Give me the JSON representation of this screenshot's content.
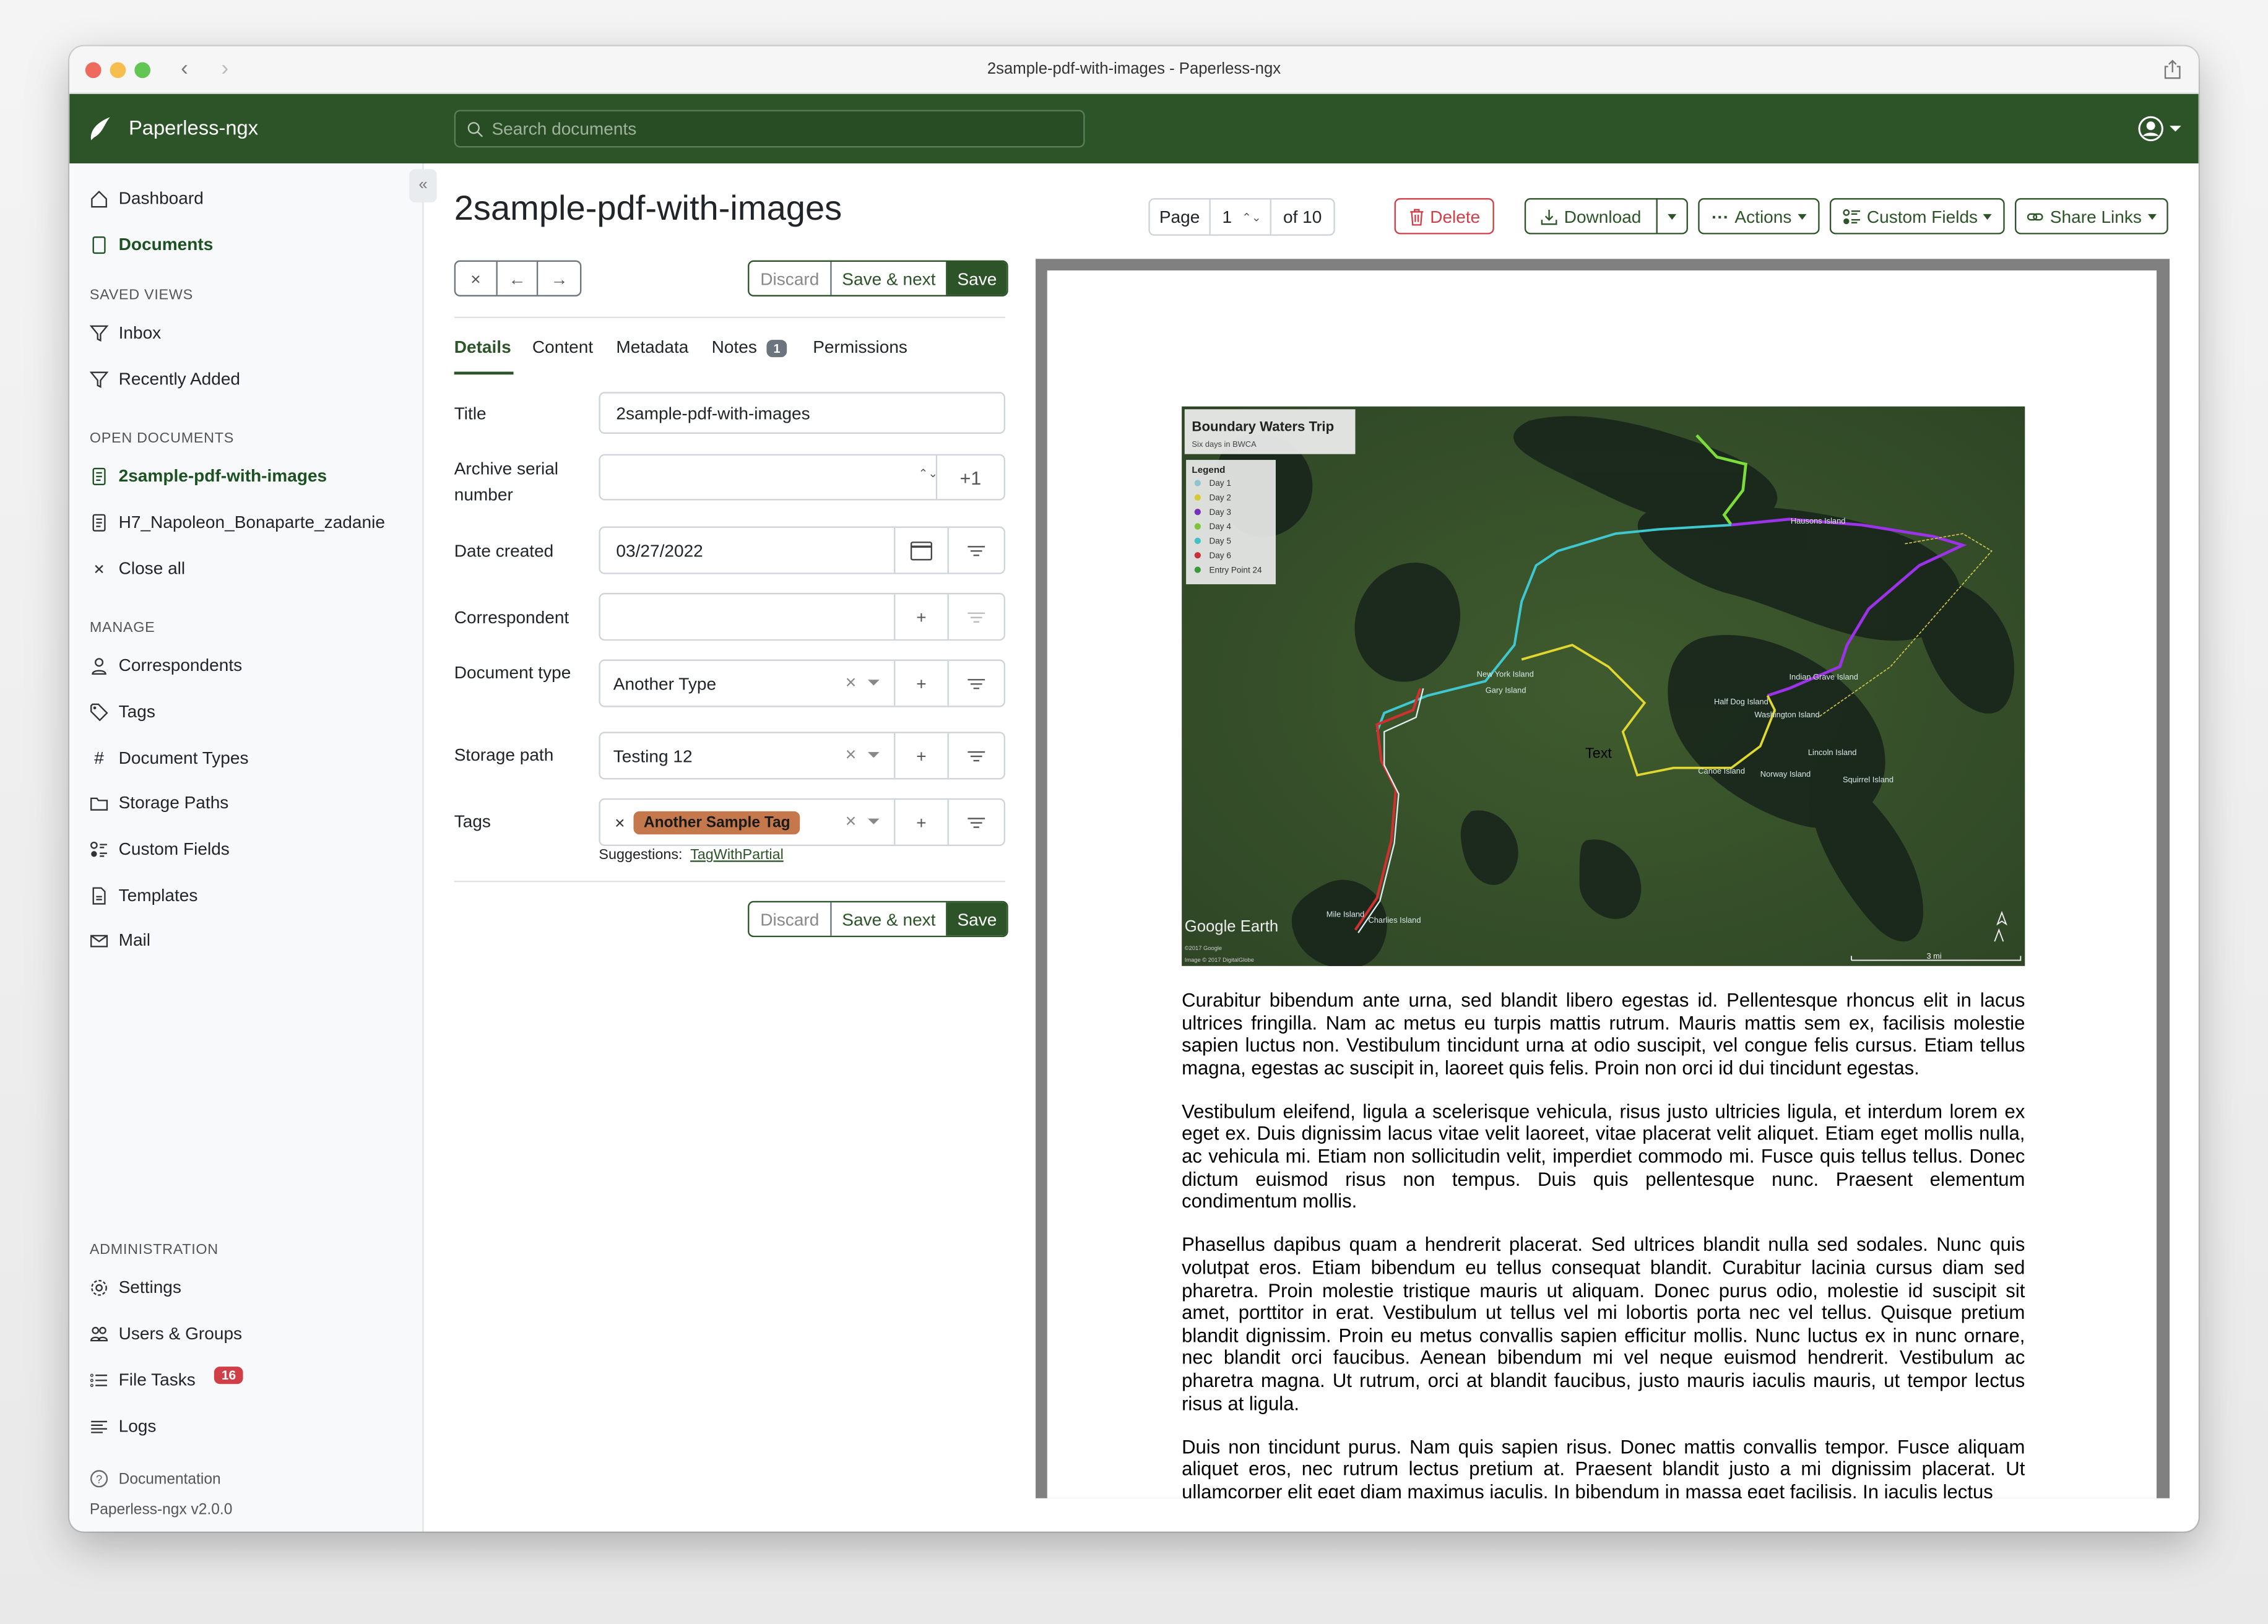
{
  "window": {
    "title": "2sample-pdf-with-images - Paperless-ngx"
  },
  "navbar": {
    "brand": "Paperless-ngx",
    "search_placeholder": "Search documents"
  },
  "sidebar": {
    "main": [
      {
        "label": "Dashboard",
        "icon": "house-icon"
      },
      {
        "label": "Documents",
        "icon": "files-icon",
        "active": true
      }
    ],
    "saved_views_header": "SAVED VIEWS",
    "saved_views": [
      {
        "label": "Inbox"
      },
      {
        "label": "Recently Added"
      }
    ],
    "open_documents_header": "OPEN DOCUMENTS",
    "open_documents": [
      {
        "label": "2sample-pdf-with-images",
        "active": true
      },
      {
        "label": "H7_Napoleon_Bonaparte_zadanie"
      }
    ],
    "close_all": "Close all",
    "manage_header": "MANAGE",
    "manage": [
      {
        "label": "Correspondents"
      },
      {
        "label": "Tags"
      },
      {
        "label": "Document Types"
      },
      {
        "label": "Storage Paths"
      },
      {
        "label": "Custom Fields"
      },
      {
        "label": "Templates"
      },
      {
        "label": "Mail"
      }
    ],
    "admin_header": "ADMINISTRATION",
    "admin": [
      {
        "label": "Settings"
      },
      {
        "label": "Users & Groups"
      },
      {
        "label": "File Tasks",
        "badge": "16"
      },
      {
        "label": "Logs"
      }
    ],
    "documentation": "Documentation",
    "version": "Paperless-ngx v2.0.0"
  },
  "document": {
    "title": "2sample-pdf-with-images",
    "pager": {
      "label": "Page",
      "current": "1",
      "of": "of 10"
    },
    "toolbar": {
      "delete": "Delete",
      "download": "Download",
      "actions": "Actions",
      "custom_fields": "Custom Fields",
      "share_links": "Share Links"
    },
    "buttons": {
      "discard": "Discard",
      "save_next": "Save & next",
      "save": "Save"
    },
    "tabs": [
      {
        "label": "Details",
        "active": true
      },
      {
        "label": "Content"
      },
      {
        "label": "Metadata"
      },
      {
        "label": "Notes",
        "badge": "1"
      },
      {
        "label": "Permissions"
      }
    ],
    "fields": {
      "title": {
        "label": "Title",
        "value": "2sample-pdf-with-images"
      },
      "asn": {
        "label": "Archive serial number",
        "value": "",
        "increment": "+1"
      },
      "date": {
        "label": "Date created",
        "value": "03/27/2022"
      },
      "correspondent": {
        "label": "Correspondent",
        "value": ""
      },
      "document_type": {
        "label": "Document type",
        "value": "Another Type"
      },
      "storage_path": {
        "label": "Storage path",
        "value": "Testing 12"
      },
      "tags": {
        "label": "Tags",
        "values": [
          "Another Sample Tag"
        ],
        "tag_color": "#c5784b"
      },
      "suggestions_label": "Suggestions:",
      "suggestions": [
        "TagWithPartial"
      ]
    }
  },
  "preview": {
    "map": {
      "title": "Boundary Waters Trip",
      "subtitle": "Six days in BWCA",
      "legend_title": "Legend",
      "legend": [
        {
          "label": "Day 1",
          "color": "#8fc3d0"
        },
        {
          "label": "Day 2",
          "color": "#d8c838"
        },
        {
          "label": "Day 3",
          "color": "#7a2fb8"
        },
        {
          "label": "Day 4",
          "color": "#7cc43a"
        },
        {
          "label": "Day 5",
          "color": "#41c0c8"
        },
        {
          "label": "Day 6",
          "color": "#c8303a"
        },
        {
          "label": "Entry Point 24",
          "color": "#3a9a3a"
        }
      ],
      "places": [
        "Hausons Island",
        "New York Island",
        "Gary Island",
        "Indian Grave Island",
        "Half Dog Island",
        "Washington Island",
        "Lincoln Island",
        "Canoe Island",
        "Norway Island",
        "Squirrel Island",
        "Mile Island",
        "Charlies Island",
        "Text"
      ],
      "brand": "Google Earth",
      "copyright1": "©2017 Google",
      "copyright2": "Image © 2017 DigitalGlobe",
      "scale": "3 mi"
    },
    "paragraphs": [
      "Curabitur bibendum ante urna, sed blandit libero egestas id. Pellentesque rhoncus elit in lacus ultrices fringilla. Nam ac metus eu turpis mattis rutrum. Mauris mattis sem ex, facilisis molestie sapien luctus non. Vestibulum tincidunt urna at odio suscipit, vel congue felis cursus. Etiam tellus magna, egestas ac suscipit in, laoreet quis felis. Proin non orci id dui tincidunt egestas.",
      "Vestibulum eleifend, ligula a scelerisque vehicula, risus justo ultricies ligula, et interdum lorem ex eget ex. Duis dignissim lacus vitae velit laoreet, vitae placerat velit aliquet. Etiam eget mollis nulla, ac vehicula mi. Etiam non sollicitudin velit, imperdiet commodo mi. Fusce quis tellus tellus. Donec dictum euismod risus non tempus. Duis quis pellentesque nunc. Praesent elementum condimentum mollis.",
      "Phasellus dapibus quam a hendrerit placerat. Sed ultrices blandit nulla sed sodales. Nunc quis volutpat eros. Etiam bibendum eu tellus consequat blandit. Curabitur lacinia cursus diam sed pharetra. Proin molestie tristique mauris ut aliquam. Donec purus odio, molestie id suscipit sit amet, porttitor in erat. Vestibulum ut tellus vel mi lobortis porta nec vel tellus. Quisque pretium blandit dignissim. Proin eu metus convallis sapien efficitur mollis. Nunc luctus ex in nunc ornare, nec blandit orci faucibus. Aenean bibendum mi vel neque euismod hendrerit. Vestibulum ac pharetra magna. Ut rutrum, orci at blandit faucibus, justo mauris iaculis mauris, ut tempor lectus risus at ligula.",
      "Duis non tincidunt purus. Nam quis sapien risus. Donec mattis convallis tempor. Fusce aliquam aliquet eros, nec rutrum lectus pretium at. Praesent blandit justo a mi dignissim placerat. Ut ullamcorper elit eget diam maximus iaculis. In bibendum in massa eget facilisis. In iaculis lectus"
    ]
  },
  "colors": {
    "primary": "#2c5428",
    "danger": "#d03f48",
    "sidebar_bg": "#f8f9fa"
  }
}
